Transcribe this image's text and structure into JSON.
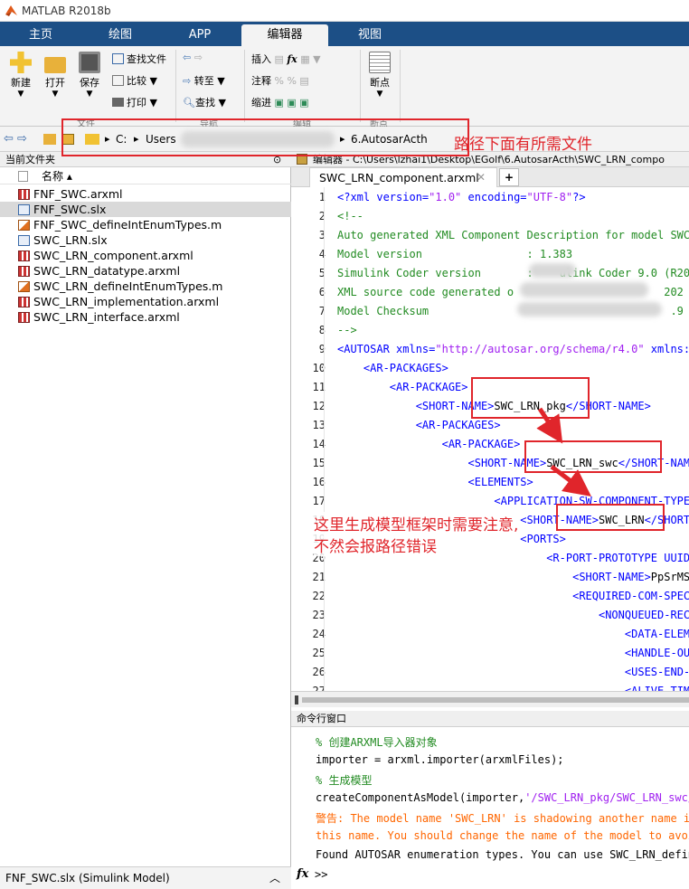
{
  "window": {
    "title": "MATLAB R2018b"
  },
  "ribbon_tabs": [
    "主页",
    "绘图",
    "APP",
    "编辑器",
    "视图"
  ],
  "ribbon": {
    "new": "新建",
    "open": "打开",
    "save": "保存",
    "find_files": "查找文件",
    "compare": "比较",
    "print": "打印",
    "goto": "转至",
    "find": "查找",
    "insert": "插入",
    "comment": "注释",
    "indent": "缩进",
    "breakpoints": "断点",
    "fx": "fx",
    "sections": {
      "file": "文件",
      "nav": "导航",
      "edit": "编辑",
      "bp": "断点"
    }
  },
  "address": {
    "drive": "C:",
    "sep": "▸",
    "seg1": "Users",
    "last": "6.AutosarActh"
  },
  "current_folder": {
    "title": "当前文件夹",
    "col_name": "名称 ▴",
    "files": [
      {
        "name": "FNF_SWC.arxml",
        "type": "arx"
      },
      {
        "name": "FNF_SWC.slx",
        "type": "slx"
      },
      {
        "name": "FNF_SWC_defineIntEnumTypes.m",
        "type": "m"
      },
      {
        "name": "SWC_LRN.slx",
        "type": "slx"
      },
      {
        "name": "SWC_LRN_component.arxml",
        "type": "arx"
      },
      {
        "name": "SWC_LRN_datatype.arxml",
        "type": "arx"
      },
      {
        "name": "SWC_LRN_defineIntEnumTypes.m",
        "type": "m"
      },
      {
        "name": "SWC_LRN_implementation.arxml",
        "type": "arx"
      },
      {
        "name": "SWC_LRN_interface.arxml",
        "type": "arx"
      }
    ],
    "status": "FNF_SWC.slx  (Simulink Model)"
  },
  "editor": {
    "header": "编辑器 - C:\\Users\\lzhai1\\Desktop\\EGolf\\6.AutosarActh\\SWC_LRN_compo",
    "tab": "SWC_LRN_component.arxml",
    "close": "✕",
    "plus": "+",
    "lines": [
      "<?xml version=\"1.0\" encoding=\"UTF-8\"?>",
      "<!--",
      "Auto generated XML Component Description for model SWC",
      "Model version                : 1.383",
      "Simulink Coder version       :    ulink Coder 9.0 (R20",
      "XML source code generated o                       202",
      "Model Checksum                                     .9 5",
      "-->",
      "<AUTOSAR xmlns=\"http://autosar.org/schema/r4.0\" xmlns:",
      "    <AR-PACKAGES>",
      "        <AR-PACKAGE>",
      "            <SHORT-NAME>SWC_LRN_pkg</SHORT-NAME>",
      "            <AR-PACKAGES>",
      "                <AR-PACKAGE>",
      "                    <SHORT-NAME>SWC_LRN_swc</SHORT-NAM",
      "                    <ELEMENTS>",
      "                        <APPLICATION-SW-COMPONENT-TYPE",
      "                            <SHORT-NAME>SWC_LRN</SHORT",
      "                            <PORTS>",
      "                                <R-PORT-PROTOTYPE UUID",
      "                                    <SHORT-NAME>PpSrMS",
      "                                    <REQUIRED-COM-SPEC",
      "                                        <NONQUEUED-REC",
      "                                            <DATA-ELEM",
      "                                            <HANDLE-OU",
      "                                            <USES-END-",
      "                                            <ALIVE-TIM"
    ]
  },
  "command_window": {
    "title": "命令行窗口",
    "lines": [
      "% 创建ARXML导入器对象",
      "importer = arxml.importer(arxmlFiles);",
      "% 生成模型",
      "createComponentAsModel(importer,'/SWC_LRN_pkg/SWC_LRN_swc/",
      "警告: The model name 'SWC_LRN' is shadowing another name i",
      "this name. You should change the name of the model to avoi",
      "Found AUTOSAR enumeration types. You can use SWC_LRN_defin"
    ],
    "prompt": "fx",
    "prompt_arrows": ">>"
  },
  "annotations": {
    "path_note": "路径下面有所需文件",
    "model_note_1": "这里生成模型框架时需要注意,",
    "model_note_2": "不然会报路径错误",
    "color": "#e0252b"
  }
}
